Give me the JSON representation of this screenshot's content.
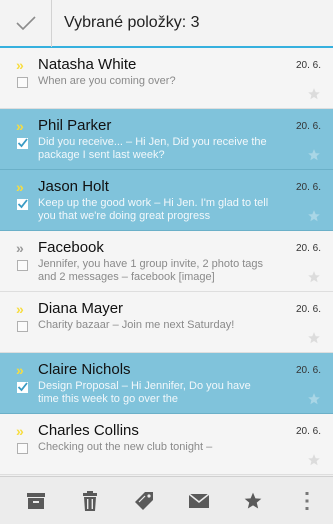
{
  "header": {
    "title": "Vybrané položky: 3"
  },
  "messages": [
    {
      "sender": "Natasha White",
      "snippet": "When are you coming over?",
      "date": "20. 6.",
      "selected": false,
      "chevron": "yellow"
    },
    {
      "sender": "Phil Parker",
      "snippet": "Did you receive... – Hi Jen, Did you receive the package I sent last week?",
      "date": "20. 6.",
      "selected": true,
      "chevron": "yellow"
    },
    {
      "sender": "Jason Holt",
      "snippet": "Keep up the good work – Hi Jen. I'm glad to tell you that we're doing great progress",
      "date": "20. 6.",
      "selected": true,
      "chevron": "yellow"
    },
    {
      "sender": "Facebook",
      "snippet": "Jennifer, you have 1 group invite, 2 photo tags and 2 messages – facebook [image]",
      "date": "20. 6.",
      "selected": false,
      "chevron": "grey"
    },
    {
      "sender": "Diana Mayer",
      "snippet": "Charity bazaar – Join me next Saturday!",
      "date": "20. 6.",
      "selected": false,
      "chevron": "yellow"
    },
    {
      "sender": "Claire Nichols",
      "snippet": "Design Proposal – Hi Jennifer, Do you have time this week to go over the",
      "date": "20. 6.",
      "selected": true,
      "chevron": "yellow"
    },
    {
      "sender": "Charles Collins",
      "snippet": "Checking out the new club tonight –",
      "date": "20. 6.",
      "selected": false,
      "chevron": "yellow"
    }
  ],
  "toolbar": {
    "icons": [
      "archive-icon",
      "trash-icon",
      "label-icon",
      "mark-unread-icon",
      "star-icon",
      "overflow-menu-icon"
    ]
  },
  "colors": {
    "accent": "#35b0de",
    "selected_row": "#80c3db",
    "chevron_yellow": "#f7dd40"
  }
}
